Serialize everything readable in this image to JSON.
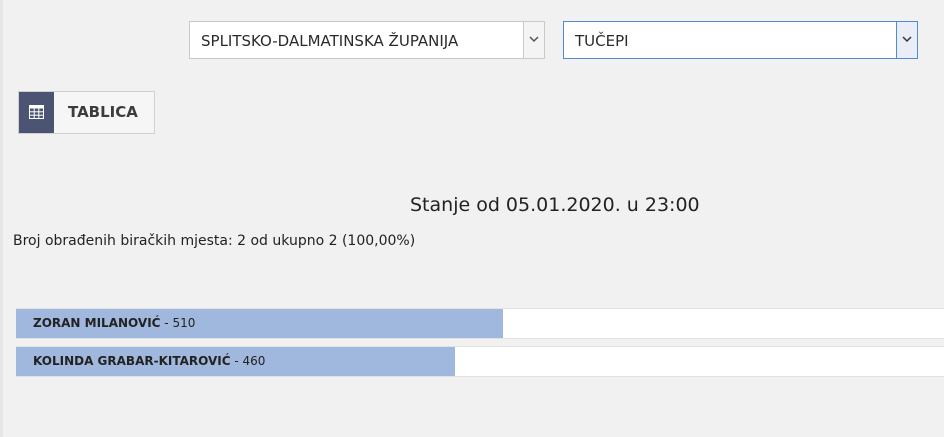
{
  "filters": {
    "county_selected": "SPLITSKO-DALMATINSKA ŽUPANIJA",
    "city_selected": "TUČEPI"
  },
  "view_toggle": {
    "label": "TABLICA",
    "icon": "table-icon"
  },
  "results": {
    "status_title": "Stanje od 05.01.2020. u 23:00",
    "processed_text": "Broj obrađenih biračkih mjesta: 2 od ukupno 2 (100,00%)",
    "max_votes": 970,
    "candidates": [
      {
        "name": "ZORAN MILANOVIĆ",
        "votes_text": " - 510",
        "votes": 510
      },
      {
        "name": "KOLINDA GRABAR-KITAROVIĆ",
        "votes_text": " - 460",
        "votes": 460
      }
    ]
  },
  "colors": {
    "bar_fill": "#a1b8de",
    "icon_box": "#4b5573",
    "focus_border": "#4f8bd0"
  }
}
